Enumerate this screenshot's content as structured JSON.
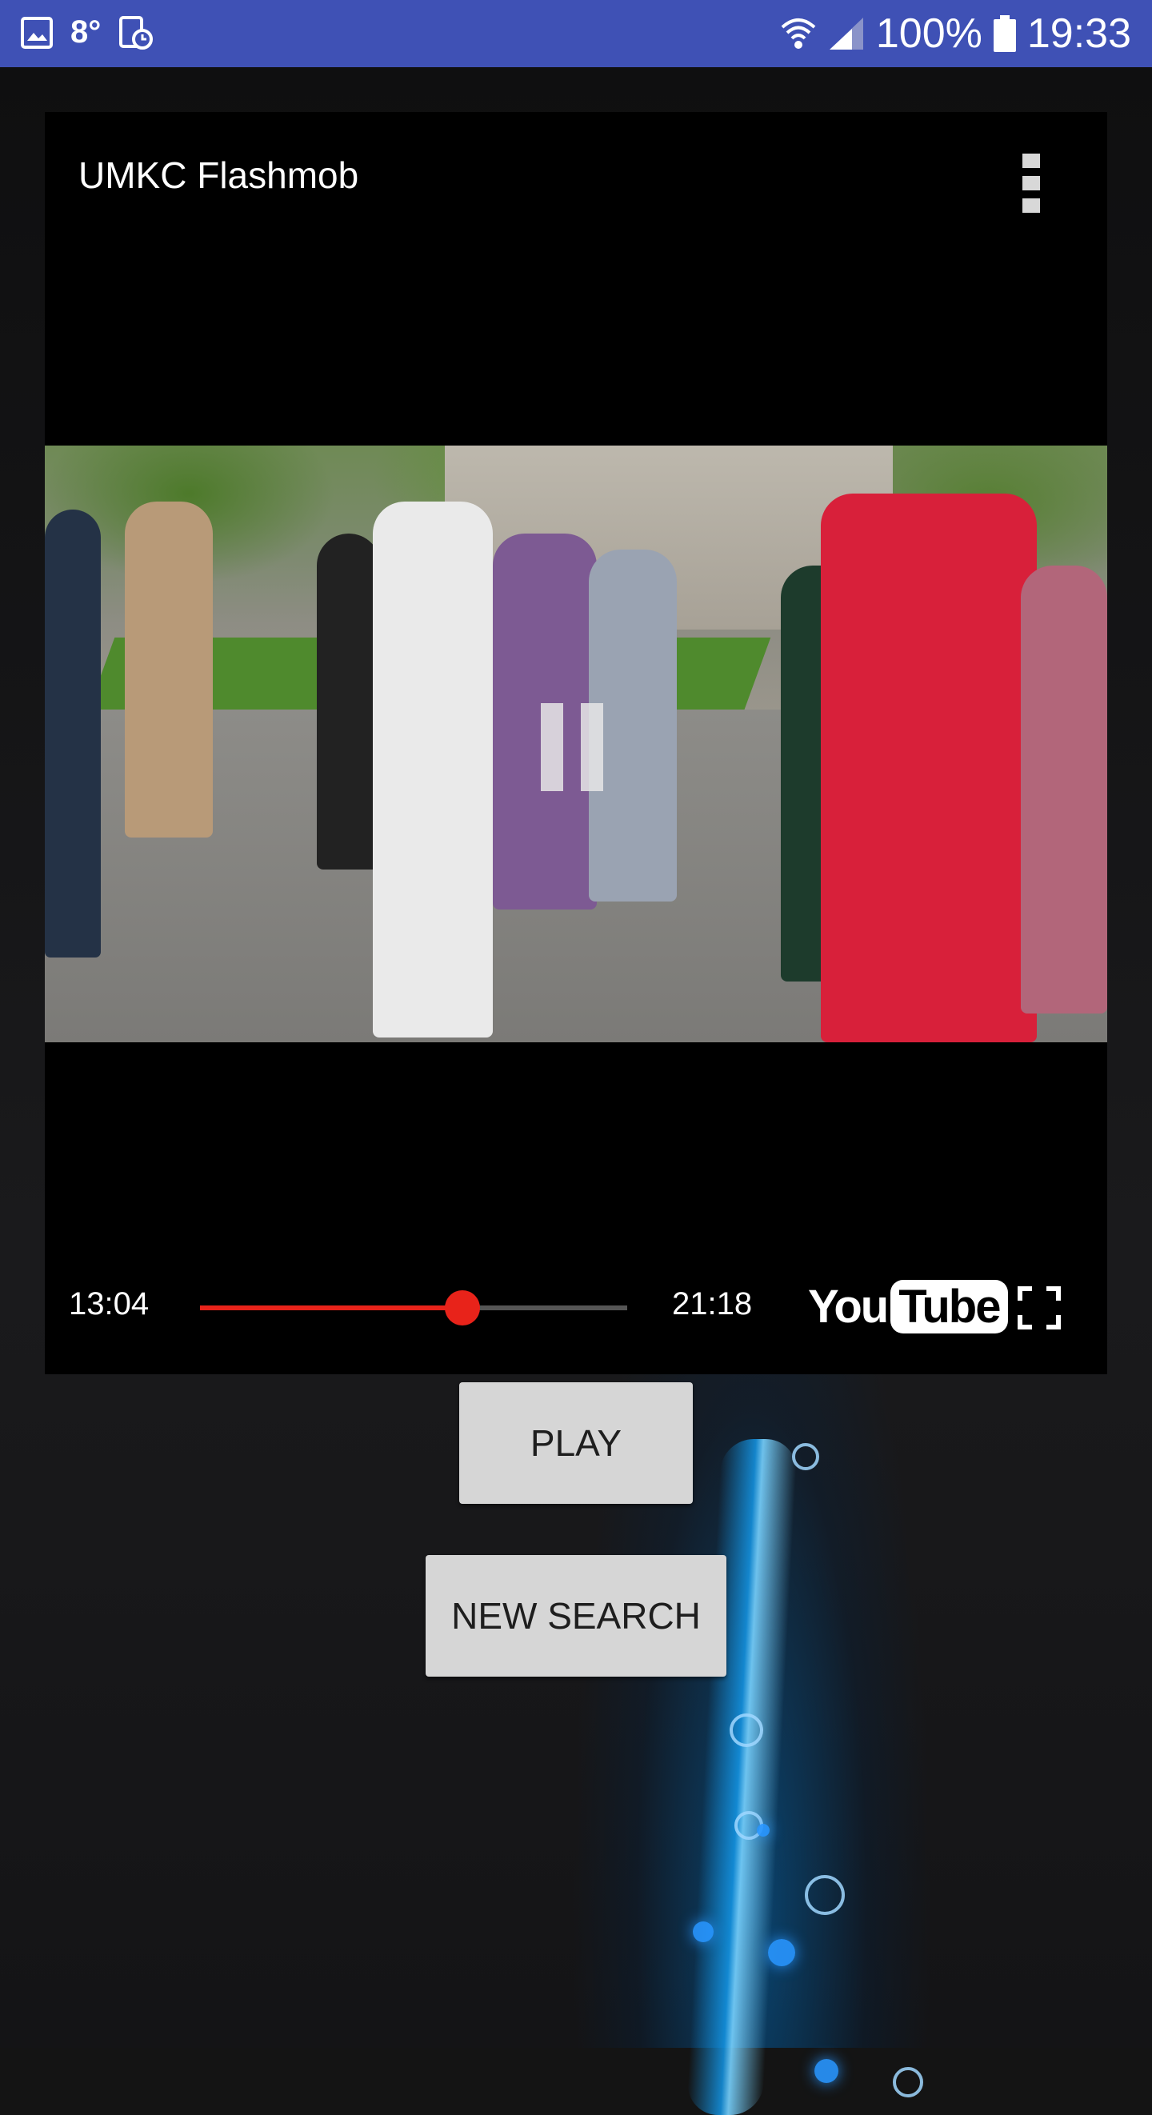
{
  "status_bar": {
    "icons": [
      "gallery-icon",
      "weather-icon",
      "screen-recorder-icon",
      "wifi-icon",
      "signal-icon",
      "battery-icon"
    ],
    "temperature": "8°",
    "battery": "100%",
    "time": "19:33",
    "bg_color": "#3F51B5"
  },
  "player": {
    "title": "UMKC Flashmob",
    "current_time": "13:04",
    "total_time": "21:18",
    "progress": 0.615,
    "logo_you": "You",
    "logo_tube": "Tube",
    "accent_color": "#E8231A"
  },
  "buttons": {
    "play": "PLAY",
    "new_search": "NEW SEARCH"
  }
}
